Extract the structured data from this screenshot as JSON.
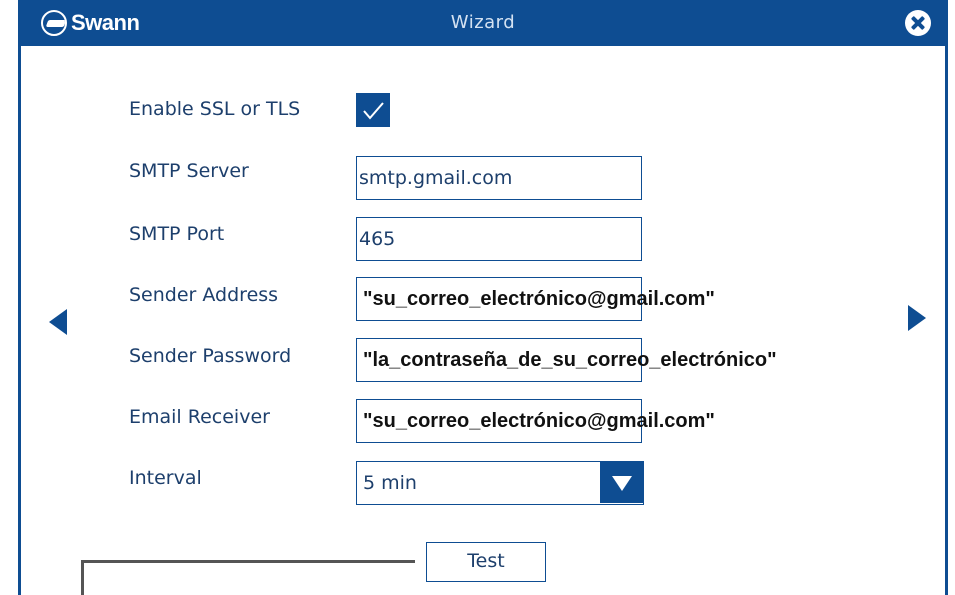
{
  "window": {
    "logo_text": "Swann",
    "title": "Wizard",
    "close_icon": "close-icon"
  },
  "form": {
    "ssl": {
      "label": "Enable SSL or TLS",
      "checked": true
    },
    "smtp_server": {
      "label": "SMTP Server",
      "value": "smtp.gmail.com"
    },
    "smtp_port": {
      "label": "SMTP Port",
      "value": "465"
    },
    "sender_address": {
      "label": "Sender Address",
      "value": "\"su_correo_electrónico@gmail.com\""
    },
    "sender_password": {
      "label": "Sender Password",
      "value": "\"la_contraseña_de_su_correo_electrónico\""
    },
    "email_receiver": {
      "label": "Email Receiver",
      "value": "\"su_correo_electrónico@gmail.com\""
    },
    "interval": {
      "label": "Interval",
      "value": "5 min"
    }
  },
  "buttons": {
    "test_label": "Test"
  },
  "colors": {
    "brand_blue": "#0e4d92",
    "label_text": "#1d3f6c"
  }
}
